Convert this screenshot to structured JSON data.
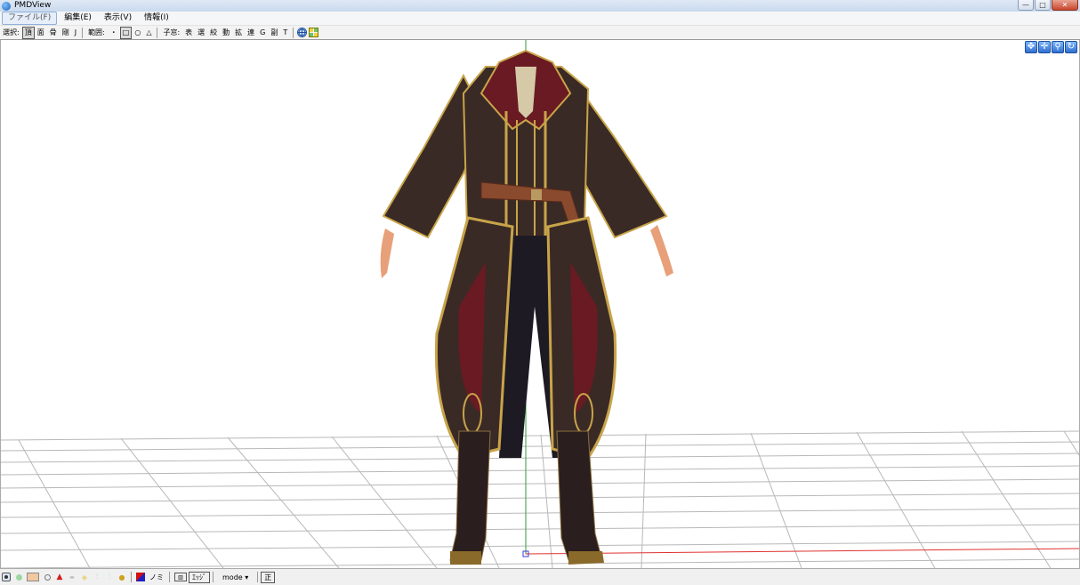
{
  "window": {
    "title": "PMDView",
    "minimize": "—",
    "maximize": "□",
    "close": "✕"
  },
  "menu": [
    {
      "label": "ファイル(F)"
    },
    {
      "label": "編集(E)"
    },
    {
      "label": "表示(V)"
    },
    {
      "label": "情報(I)"
    }
  ],
  "toolbar": {
    "select_label": "選択:",
    "select_items": [
      "頂",
      "面",
      "骨",
      "剛",
      "J"
    ],
    "range_label": "範囲:",
    "range_items": [
      "・",
      "□",
      "○",
      "△"
    ],
    "child_label": "子窓:",
    "child_items": [
      "表",
      "選",
      "絞",
      "動",
      "拡",
      "連",
      "G",
      "副",
      "T"
    ]
  },
  "statusbar": {
    "text1": "ノミ",
    "text2": "ｴｯｼﾞ",
    "mode": "mode ▾",
    "text3": "正"
  },
  "colors": {
    "accent": "#3b78d8",
    "grid": "#b8b8b8",
    "axis_green": "#2e9b3a",
    "axis_red": "#e03030",
    "coat": "#3a2a25",
    "trim": "#c8a44a",
    "lining": "#6a1a22"
  }
}
